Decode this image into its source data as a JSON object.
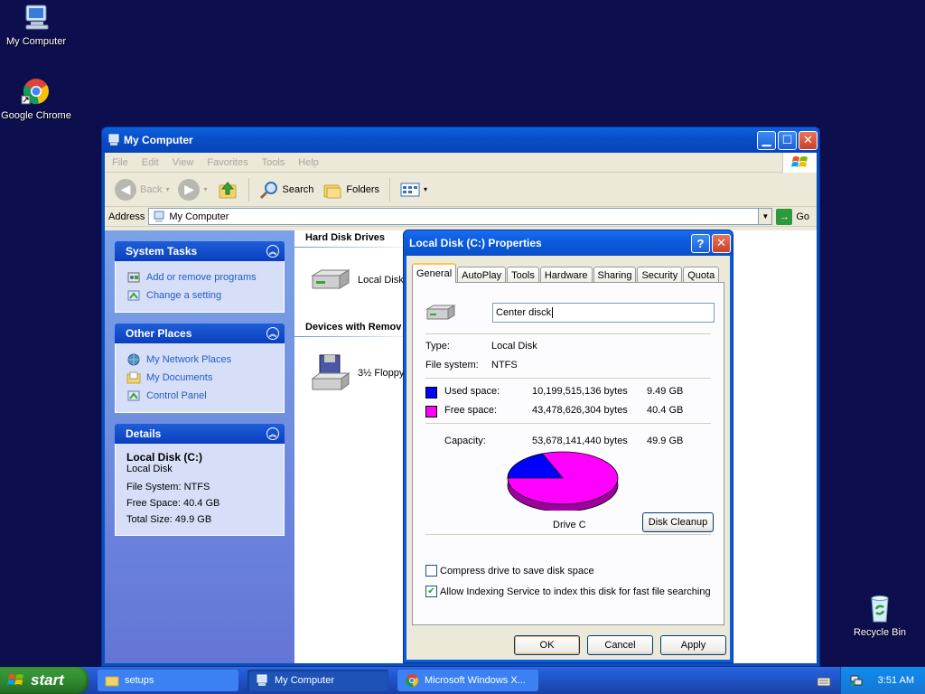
{
  "desktop": {
    "icons": [
      {
        "label": "My Computer"
      },
      {
        "label": "Google Chrome"
      },
      {
        "label": "Recycle Bin"
      }
    ]
  },
  "window": {
    "title": "My Computer",
    "menu": [
      "File",
      "Edit",
      "View",
      "Favorites",
      "Tools",
      "Help"
    ],
    "toolbar": {
      "back": "Back",
      "search": "Search",
      "folders": "Folders"
    },
    "address": {
      "label": "Address",
      "value": "My Computer",
      "go": "Go"
    },
    "left_pane": {
      "system_tasks": {
        "title": "System Tasks",
        "links": [
          "Add or remove programs",
          "Change a setting"
        ]
      },
      "other_places": {
        "title": "Other Places",
        "links": [
          "My Network Places",
          "My Documents",
          "Control Panel"
        ]
      },
      "details": {
        "title": "Details",
        "name": "Local Disk (C:)",
        "type": "Local Disk",
        "file_system": "File System: NTFS",
        "free_space": "Free Space: 40.4 GB",
        "total_size": "Total Size: 49.9 GB"
      }
    },
    "right_pane": {
      "group1": "Hard Disk Drives",
      "drive1": "Local Disk (",
      "group2": "Devices with Remov",
      "drive2": "3½ Floppy"
    }
  },
  "dialog": {
    "title": "Local Disk (C:) Properties",
    "tabs": [
      "General",
      "AutoPlay",
      "Tools",
      "Hardware",
      "Sharing",
      "Security",
      "Quota"
    ],
    "label_value": "Center disck",
    "type_label": "Type:",
    "type_value": "Local Disk",
    "fs_label": "File system:",
    "fs_value": "NTFS",
    "used_label": "Used space:",
    "used_bytes": "10,199,515,136 bytes",
    "used_gb": "9.49 GB",
    "free_label": "Free space:",
    "free_bytes": "43,478,626,304 bytes",
    "free_gb": "40.4 GB",
    "cap_label": "Capacity:",
    "cap_bytes": "53,678,141,440 bytes",
    "cap_gb": "49.9 GB",
    "drive_label": "Drive C",
    "cleanup": "Disk Cleanup",
    "compress": "Compress drive to save disk space",
    "indexing": "Allow Indexing Service to index this disk for fast file searching",
    "compress_checked": false,
    "indexing_checked": true,
    "used_fraction": 0.19,
    "ok": "OK",
    "cancel": "Cancel",
    "apply": "Apply",
    "colors": {
      "used": "#0000ff",
      "free": "#ff00ff"
    }
  },
  "taskbar": {
    "start": "start",
    "tasks": [
      "setups",
      "My Computer",
      "Microsoft Windows X..."
    ],
    "clock": "3:51 AM"
  }
}
